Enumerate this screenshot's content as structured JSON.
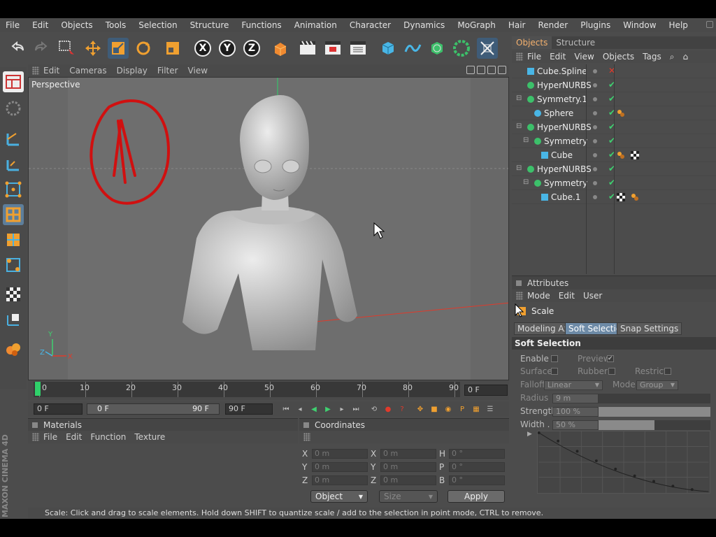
{
  "menubar": [
    "File",
    "Edit",
    "Objects",
    "Tools",
    "Selection",
    "Structure",
    "Functions",
    "Animation",
    "Character",
    "Dynamics",
    "MoGraph",
    "Hair",
    "Render",
    "Plugins",
    "Window",
    "Help"
  ],
  "viewport": {
    "menu": [
      "Edit",
      "Cameras",
      "Display",
      "Filter",
      "View"
    ],
    "label": "Perspective"
  },
  "timeline": {
    "ticks": [
      "0",
      "10",
      "20",
      "30",
      "40",
      "50",
      "60",
      "70",
      "80",
      "90"
    ],
    "current_frame": "0 F"
  },
  "playbar": {
    "start": "0 F",
    "range_start": "0 F",
    "range_end": "90 F",
    "end": "90 F"
  },
  "materials": {
    "title": "Materials",
    "menu": [
      "File",
      "Edit",
      "Function",
      "Texture"
    ]
  },
  "coordinates": {
    "title": "Coordinates",
    "rows": [
      {
        "l1": "X",
        "v1": "0 m",
        "l2": "X",
        "v2": "0 m",
        "l3": "H",
        "v3": "0 °"
      },
      {
        "l1": "Y",
        "v1": "0 m",
        "l2": "Y",
        "v2": "0 m",
        "l3": "P",
        "v3": "0 °"
      },
      {
        "l1": "Z",
        "v1": "0 m",
        "l2": "Z",
        "v2": "0 m",
        "l3": "B",
        "v3": "0 °"
      }
    ],
    "mode": "Object",
    "size": "Size",
    "apply": "Apply"
  },
  "status": "Scale: Click and drag to scale elements. Hold down SHIFT to quantize scale / add to the selection in point mode, CTRL to remove.",
  "object_manager": {
    "tabs": [
      "Objects",
      "Structure"
    ],
    "menu": [
      "File",
      "Edit",
      "View",
      "Objects",
      "Tags"
    ],
    "objects": [
      {
        "name": "Cube.Spline",
        "state": "cross"
      },
      {
        "name": "HyperNURBS",
        "state": "check"
      },
      {
        "name": "Symmetry.1",
        "state": "check"
      },
      {
        "name": "Sphere",
        "state": "check"
      },
      {
        "name": "HyperNURBS",
        "state": "check"
      },
      {
        "name": "Symmetry",
        "state": "check"
      },
      {
        "name": "Cube",
        "state": "check"
      },
      {
        "name": "HyperNURBS",
        "state": "check"
      },
      {
        "name": "Symmetry",
        "state": "check"
      },
      {
        "name": "Cube.1",
        "state": "check"
      }
    ]
  },
  "attributes": {
    "title": "Attributes",
    "menu": [
      "Mode",
      "Edit",
      "User"
    ],
    "tool": "Scale",
    "tabs": [
      "Modeling Axis",
      "Soft Selection",
      "Snap Settings"
    ],
    "section": "Soft Selection",
    "enable": "Enable",
    "preview": "Preview",
    "surface": "Surface",
    "rubber": "Rubber",
    "restrict": "Restrict",
    "falloff_label": "Falloff",
    "falloff_value": "Linear",
    "mode_label": "Mode",
    "mode_value": "Group",
    "radius_label": "Radius",
    "radius_value": "9 m",
    "strength_label": "Strength",
    "strength_value": "100 %",
    "strength_level": 100,
    "width_label": "Width . .",
    "width_value": "50 %",
    "width_level": 50
  },
  "branding": "MAXON CINEMA 4D",
  "colors": {
    "accent": "#f5b16e",
    "selected_tab": "#6d8aa6",
    "check": "#3fd070",
    "cross": "#e03a2b",
    "annotation": "#d01010"
  }
}
